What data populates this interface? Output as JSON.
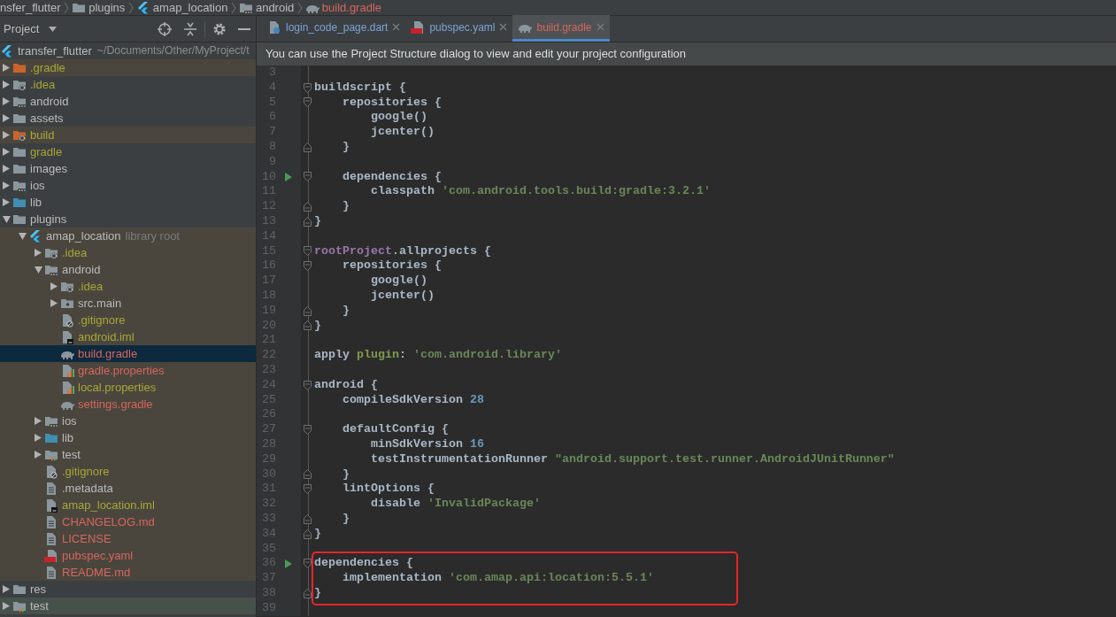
{
  "breadcrumbs": [
    {
      "label": "nsfer_flutter",
      "kind": "text",
      "unversioned": false
    },
    {
      "label": "plugins",
      "kind": "folder",
      "unversioned": false
    },
    {
      "label": "amap_location",
      "kind": "flutter",
      "unversioned": false
    },
    {
      "label": "android",
      "kind": "folder-android",
      "unversioned": false
    },
    {
      "label": "build.gradle",
      "kind": "gradle",
      "unversioned": true
    }
  ],
  "project_panel": {
    "title": "Project",
    "root": {
      "label": "transfer_flutter",
      "path": "~/Documents/Other/MyProject/t"
    },
    "tree": [
      {
        "label": ".gradle",
        "kind": "folder-orange",
        "ignored": true,
        "unversioned": false,
        "excluded": true,
        "test": false,
        "expanded": false,
        "selected": false
      },
      {
        "label": ".idea",
        "kind": "folder-gear",
        "ignored": true,
        "unversioned": false,
        "excluded": false,
        "test": false,
        "expanded": false,
        "selected": false
      },
      {
        "label": "android",
        "kind": "folder-android",
        "ignored": false,
        "unversioned": false,
        "excluded": false,
        "test": false,
        "expanded": false,
        "selected": false
      },
      {
        "label": "assets",
        "kind": "folder",
        "ignored": false,
        "unversioned": false,
        "excluded": false,
        "test": false,
        "expanded": false,
        "selected": false
      },
      {
        "label": "build",
        "kind": "folder-orange-gear",
        "ignored": true,
        "unversioned": false,
        "excluded": true,
        "test": false,
        "expanded": false,
        "selected": false
      },
      {
        "label": "gradle",
        "kind": "folder",
        "ignored": true,
        "unversioned": false,
        "excluded": false,
        "test": false,
        "expanded": false,
        "selected": false
      },
      {
        "label": "images",
        "kind": "folder",
        "ignored": false,
        "unversioned": false,
        "excluded": false,
        "test": false,
        "expanded": false,
        "selected": false
      },
      {
        "label": "ios",
        "kind": "folder-android",
        "ignored": false,
        "unversioned": false,
        "excluded": false,
        "test": false,
        "expanded": false,
        "selected": false
      },
      {
        "label": "lib",
        "kind": "folder-blue",
        "ignored": false,
        "unversioned": false,
        "excluded": false,
        "test": false,
        "expanded": false,
        "selected": false
      },
      {
        "label": "plugins",
        "kind": "folder",
        "ignored": false,
        "unversioned": false,
        "excluded": false,
        "test": false,
        "expanded": true,
        "selected": false,
        "children": [
          {
            "label": "amap_location",
            "suffix": "library root",
            "kind": "flutter",
            "ignored": false,
            "unversioned": false,
            "excluded": true,
            "test": false,
            "expanded": true,
            "selected": false,
            "children": [
              {
                "label": ".idea",
                "kind": "folder-gear",
                "ignored": true,
                "unversioned": false,
                "excluded": true,
                "test": false,
                "expanded": false,
                "selected": false
              },
              {
                "label": "android",
                "kind": "folder-android",
                "ignored": false,
                "unversioned": false,
                "excluded": true,
                "test": false,
                "expanded": true,
                "selected": false,
                "children": [
                  {
                    "label": ".idea",
                    "kind": "folder-gear",
                    "ignored": true,
                    "unversioned": false,
                    "excluded": true,
                    "test": false,
                    "expanded": false,
                    "selected": false
                  },
                  {
                    "label": "src.main",
                    "kind": "folder-module",
                    "ignored": false,
                    "unversioned": false,
                    "excluded": true,
                    "test": false,
                    "expanded": false,
                    "selected": false
                  },
                  {
                    "label": ".gitignore",
                    "kind": "file-ignore",
                    "ignored": true,
                    "unversioned": false,
                    "excluded": true,
                    "test": false,
                    "selected": false
                  },
                  {
                    "label": "android.iml",
                    "kind": "file-iml",
                    "ignored": true,
                    "unversioned": false,
                    "excluded": true,
                    "test": false,
                    "selected": false
                  },
                  {
                    "label": "build.gradle",
                    "kind": "gradle",
                    "ignored": false,
                    "unversioned": true,
                    "excluded": true,
                    "test": false,
                    "selected": true
                  },
                  {
                    "label": "gradle.properties",
                    "kind": "file-properties",
                    "ignored": false,
                    "unversioned": true,
                    "excluded": true,
                    "test": false,
                    "selected": false
                  },
                  {
                    "label": "local.properties",
                    "kind": "file-properties",
                    "ignored": true,
                    "unversioned": false,
                    "excluded": true,
                    "test": false,
                    "selected": false
                  },
                  {
                    "label": "settings.gradle",
                    "kind": "gradle",
                    "ignored": false,
                    "unversioned": true,
                    "excluded": true,
                    "test": false,
                    "selected": false
                  }
                ]
              },
              {
                "label": "ios",
                "kind": "folder-android",
                "ignored": false,
                "unversioned": false,
                "excluded": true,
                "test": false,
                "expanded": false,
                "selected": false
              },
              {
                "label": "lib",
                "kind": "folder-blue",
                "ignored": false,
                "unversioned": false,
                "excluded": true,
                "test": false,
                "expanded": false,
                "selected": false
              },
              {
                "label": "test",
                "kind": "folder-test",
                "ignored": false,
                "unversioned": false,
                "excluded": true,
                "test": false,
                "expanded": false,
                "selected": false
              },
              {
                "label": ".gitignore",
                "kind": "file-ignore",
                "ignored": true,
                "unversioned": false,
                "excluded": true,
                "test": false,
                "selected": false
              },
              {
                "label": ".metadata",
                "kind": "file-text",
                "ignored": false,
                "unversioned": false,
                "excluded": true,
                "test": false,
                "selected": false
              },
              {
                "label": "amap_location.iml",
                "kind": "file-iml",
                "ignored": true,
                "unversioned": false,
                "excluded": true,
                "test": false,
                "selected": false
              },
              {
                "label": "CHANGELOG.md",
                "kind": "file-text",
                "ignored": false,
                "unversioned": true,
                "excluded": true,
                "test": false,
                "selected": false
              },
              {
                "label": "LICENSE",
                "kind": "file-text",
                "ignored": false,
                "unversioned": true,
                "excluded": true,
                "test": false,
                "selected": false
              },
              {
                "label": "pubspec.yaml",
                "kind": "file-yaml",
                "ignored": false,
                "unversioned": true,
                "excluded": true,
                "test": false,
                "selected": false
              },
              {
                "label": "README.md",
                "kind": "file-text",
                "ignored": false,
                "unversioned": true,
                "excluded": true,
                "test": false,
                "selected": false
              }
            ]
          }
        ]
      },
      {
        "label": "res",
        "kind": "folder",
        "ignored": false,
        "unversioned": false,
        "excluded": false,
        "test": false,
        "expanded": false,
        "selected": false
      },
      {
        "label": "test",
        "kind": "folder-test",
        "ignored": false,
        "unversioned": false,
        "excluded": false,
        "test": true,
        "expanded": false,
        "selected": false
      }
    ]
  },
  "tabs": [
    {
      "label": "login_code_page.dart",
      "kind": "file-dart",
      "unversioned": false,
      "selected": false
    },
    {
      "label": "pubspec.yaml",
      "kind": "file-yaml",
      "unversioned": false,
      "selected": false
    },
    {
      "label": "build.gradle",
      "kind": "gradle",
      "unversioned": true,
      "selected": true
    }
  ],
  "notification": "You can use the Project Structure dialog to view and edit your project configuration",
  "editor": {
    "lines": [
      {
        "number": "3",
        "kind": "plain",
        "run": false,
        "boxed": false
      },
      {
        "number": "4",
        "kind": "fold-start",
        "run": false,
        "boxed": false,
        "tokens": [
          {
            "kind": "plain",
            "text": "buildscript {"
          }
        ]
      },
      {
        "number": "5",
        "kind": "fold-start",
        "run": false,
        "boxed": false,
        "tokens": [
          {
            "kind": "plain",
            "text": "    repositories {"
          }
        ]
      },
      {
        "number": "6",
        "kind": "plain",
        "run": false,
        "boxed": false,
        "tokens": [
          {
            "kind": "plain",
            "text": "        google()"
          }
        ]
      },
      {
        "number": "7",
        "kind": "plain",
        "run": false,
        "boxed": false,
        "tokens": [
          {
            "kind": "plain",
            "text": "        jcenter()"
          }
        ]
      },
      {
        "number": "8",
        "kind": "fold-end",
        "run": false,
        "boxed": false,
        "tokens": [
          {
            "kind": "plain",
            "text": "    }"
          }
        ]
      },
      {
        "number": "9",
        "kind": "plain",
        "run": false,
        "boxed": false
      },
      {
        "number": "10",
        "kind": "fold-start",
        "run": true,
        "boxed": false,
        "tokens": [
          {
            "kind": "plain",
            "text": "    dependencies {"
          }
        ]
      },
      {
        "number": "11",
        "kind": "plain",
        "run": false,
        "boxed": false,
        "tokens": [
          {
            "kind": "plain",
            "text": "        classpath "
          },
          {
            "kind": "string",
            "text": "'com.android.tools.build:gradle:3.2.1'"
          }
        ]
      },
      {
        "number": "12",
        "kind": "fold-end",
        "run": false,
        "boxed": false,
        "tokens": [
          {
            "kind": "plain",
            "text": "    }"
          }
        ]
      },
      {
        "number": "13",
        "kind": "fold-end",
        "run": false,
        "boxed": false,
        "tokens": [
          {
            "kind": "plain",
            "text": "}"
          }
        ]
      },
      {
        "number": "14",
        "kind": "plain",
        "run": false,
        "boxed": false
      },
      {
        "number": "15",
        "kind": "fold-start",
        "run": false,
        "boxed": false,
        "tokens": [
          {
            "kind": "keyword",
            "text": "rootProject"
          },
          {
            "kind": "plain",
            "text": ".allprojects {"
          }
        ]
      },
      {
        "number": "16",
        "kind": "fold-start",
        "run": false,
        "boxed": false,
        "tokens": [
          {
            "kind": "plain",
            "text": "    repositories {"
          }
        ]
      },
      {
        "number": "17",
        "kind": "plain",
        "run": false,
        "boxed": false,
        "tokens": [
          {
            "kind": "plain",
            "text": "        google()"
          }
        ]
      },
      {
        "number": "18",
        "kind": "plain",
        "run": false,
        "boxed": false,
        "tokens": [
          {
            "kind": "plain",
            "text": "        jcenter()"
          }
        ]
      },
      {
        "number": "19",
        "kind": "fold-end",
        "run": false,
        "boxed": false,
        "tokens": [
          {
            "kind": "plain",
            "text": "    }"
          }
        ]
      },
      {
        "number": "20",
        "kind": "fold-end",
        "run": false,
        "boxed": false,
        "tokens": [
          {
            "kind": "plain",
            "text": "}"
          }
        ]
      },
      {
        "number": "21",
        "kind": "plain",
        "run": false,
        "boxed": false
      },
      {
        "number": "22",
        "kind": "plain",
        "run": false,
        "boxed": false,
        "tokens": [
          {
            "kind": "plain",
            "text": "apply "
          },
          {
            "kind": "named",
            "text": "plugin"
          },
          {
            "kind": "plain",
            "text": ": "
          },
          {
            "kind": "string",
            "text": "'com.android.library'"
          }
        ]
      },
      {
        "number": "23",
        "kind": "plain",
        "run": false,
        "boxed": false
      },
      {
        "number": "24",
        "kind": "fold-start",
        "run": false,
        "boxed": false,
        "tokens": [
          {
            "kind": "plain",
            "text": "android {"
          }
        ]
      },
      {
        "number": "25",
        "kind": "plain",
        "run": false,
        "boxed": false,
        "tokens": [
          {
            "kind": "plain",
            "text": "    compileSdkVersion "
          },
          {
            "kind": "number",
            "text": "28"
          }
        ]
      },
      {
        "number": "26",
        "kind": "plain",
        "run": false,
        "boxed": false
      },
      {
        "number": "27",
        "kind": "fold-start",
        "run": false,
        "boxed": false,
        "tokens": [
          {
            "kind": "plain",
            "text": "    defaultConfig {"
          }
        ]
      },
      {
        "number": "28",
        "kind": "plain",
        "run": false,
        "boxed": false,
        "tokens": [
          {
            "kind": "plain",
            "text": "        minSdkVersion "
          },
          {
            "kind": "number",
            "text": "16"
          }
        ]
      },
      {
        "number": "29",
        "kind": "plain",
        "run": false,
        "boxed": false,
        "tokens": [
          {
            "kind": "plain",
            "text": "        testInstrumentationRunner "
          },
          {
            "kind": "string",
            "text": "\"android.support.test.runner.AndroidJUnitRunner\""
          }
        ]
      },
      {
        "number": "30",
        "kind": "fold-end",
        "run": false,
        "boxed": false,
        "tokens": [
          {
            "kind": "plain",
            "text": "    }"
          }
        ]
      },
      {
        "number": "31",
        "kind": "fold-start",
        "run": false,
        "boxed": false,
        "tokens": [
          {
            "kind": "plain",
            "text": "    lintOptions {"
          }
        ]
      },
      {
        "number": "32",
        "kind": "plain",
        "run": false,
        "boxed": false,
        "tokens": [
          {
            "kind": "plain",
            "text": "        disable "
          },
          {
            "kind": "string",
            "text": "'InvalidPackage'"
          }
        ]
      },
      {
        "number": "33",
        "kind": "fold-end",
        "run": false,
        "boxed": false,
        "tokens": [
          {
            "kind": "plain",
            "text": "    }"
          }
        ]
      },
      {
        "number": "34",
        "kind": "fold-end",
        "run": false,
        "boxed": false,
        "tokens": [
          {
            "kind": "plain",
            "text": "}"
          }
        ]
      },
      {
        "number": "35",
        "kind": "plain",
        "run": false,
        "boxed": false
      },
      {
        "number": "36",
        "kind": "fold-start",
        "run": true,
        "boxed": true,
        "tokens": [
          {
            "kind": "plain",
            "text": "dependencies {"
          }
        ]
      },
      {
        "number": "37",
        "kind": "plain",
        "run": false,
        "boxed": true,
        "tokens": [
          {
            "kind": "plain",
            "text": "    implementation "
          },
          {
            "kind": "string",
            "text": "'com.amap.api:location:5.5.1'"
          }
        ]
      },
      {
        "number": "38",
        "kind": "fold-end",
        "run": false,
        "boxed": true,
        "tokens": [
          {
            "kind": "plain",
            "text": "}"
          }
        ]
      },
      {
        "number": "39",
        "kind": "plain",
        "run": false,
        "boxed": false
      }
    ]
  }
}
